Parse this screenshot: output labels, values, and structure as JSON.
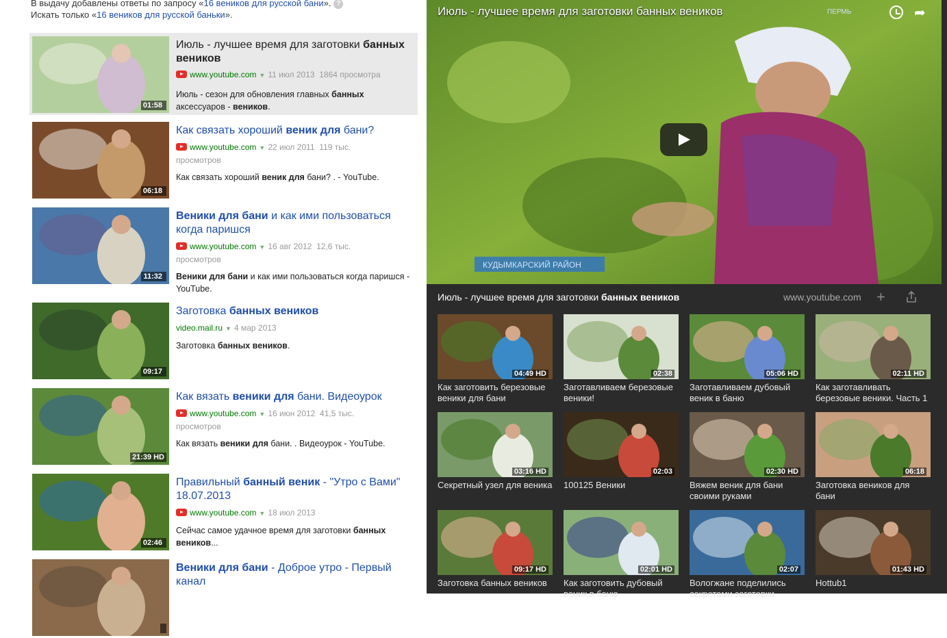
{
  "notice": {
    "line1_prefix": "В выдачу добавлены ответы по запросу «",
    "line1_link": "16 веников для русской бани",
    "line1_suffix": "».",
    "line2_prefix": "Искать только «",
    "line2_link": "16 веников для русской баньки",
    "line2_suffix": "»."
  },
  "results": [
    {
      "title_plain1": "Июль - лучшее время для заготовки ",
      "title_bold1": "банных веников",
      "title_plain2": "",
      "title_bold2": "",
      "title_plain3": "",
      "source": "www.youtube.com",
      "date": "11 июл 2013",
      "views": "1864 просмотра",
      "views2": "",
      "desc_plain1": "Июль - сезон для обновления главных ",
      "desc_bold1": "банных",
      "desc_plain2": " аксессуаров - ",
      "desc_bold2": "веников",
      "desc_plain3": ".",
      "duration": "01:58",
      "hd": ""
    },
    {
      "title_plain1": "Как связать хороший ",
      "title_bold1": "веник для",
      "title_plain2": " бани?",
      "title_bold2": "",
      "title_plain3": "",
      "source": "www.youtube.com",
      "date": "22 июл 2011",
      "views": "119 тыс.",
      "views2": "просмотров",
      "desc_plain1": "Как связать хороший ",
      "desc_bold1": "веник для",
      "desc_plain2": " бани? . - YouTube.",
      "desc_bold2": "",
      "desc_plain3": "",
      "duration": "06:18",
      "hd": ""
    },
    {
      "title_plain1": "",
      "title_bold1": "Веники для бани",
      "title_plain2": " и как ими пользоваться когда паришся",
      "title_bold2": "",
      "title_plain3": "",
      "source": "www.youtube.com",
      "date": "16 авг 2012",
      "views": "12,6 тыс.",
      "views2": "просмотров",
      "desc_plain1": "",
      "desc_bold1": "Веники для бани",
      "desc_plain2": " и как ими пользоваться когда паришся - YouTube.",
      "desc_bold2": "",
      "desc_plain3": "",
      "duration": "11:32",
      "hd": ""
    },
    {
      "title_plain1": "Заготовка ",
      "title_bold1": "банных веников",
      "title_plain2": "",
      "title_bold2": "",
      "title_plain3": "",
      "source": "video.mail.ru",
      "date": "4 мар 2013",
      "views": "",
      "views2": "",
      "desc_plain1": "Заготовка ",
      "desc_bold1": "банных веников",
      "desc_plain2": ".",
      "desc_bold2": "",
      "desc_plain3": "",
      "duration": "09:17",
      "hd": ""
    },
    {
      "title_plain1": "Как вязать ",
      "title_bold1": "веники для",
      "title_plain2": " бани. Видеоурок",
      "title_bold2": "",
      "title_plain3": "",
      "source": "www.youtube.com",
      "date": "16 июн 2012",
      "views": "41,5 тыс.",
      "views2": "просмотров",
      "desc_plain1": "Как вязать ",
      "desc_bold1": "веники для",
      "desc_plain2": " бани. . Видеоурок - YouTube.",
      "desc_bold2": "",
      "desc_plain3": "",
      "duration": "21:39",
      "hd": "HD"
    },
    {
      "title_plain1": "Правильный ",
      "title_bold1": "банный веник",
      "title_plain2": " - \"Утро с Вами\" 18.07.2013",
      "title_bold2": "",
      "title_plain3": "",
      "source": "www.youtube.com",
      "date": "18 июл 2013",
      "views": "",
      "views2": "",
      "desc_plain1": "Сейчас самое удачное время для заготовки ",
      "desc_bold1": "банных веников",
      "desc_plain2": "...",
      "desc_bold2": "",
      "desc_plain3": "",
      "duration": "02:46",
      "hd": ""
    },
    {
      "title_plain1": "",
      "title_bold1": "Веники для бани",
      "title_plain2": " - Доброе утро - Первый канал",
      "title_bold2": "",
      "title_plain3": "",
      "source": "",
      "date": "",
      "views": "",
      "views2": "",
      "desc_plain1": "",
      "desc_bold1": "",
      "desc_plain2": "",
      "desc_bold2": "",
      "desc_plain3": "",
      "duration": "",
      "hd": ""
    }
  ],
  "player": {
    "title": "Июль - лучшее время для заготовки банных веников",
    "caption_plain": "Июль - лучшее время для заготовки ",
    "caption_bold": "банных веников",
    "host": "www.youtube.com",
    "overlay_text": "КУДЫМКАРСКИЙ РАЙОН",
    "corner_text": "ПЕРМЬ"
  },
  "related": [
    {
      "title": "Как заготовить березовые веники для бани",
      "duration": "04:49",
      "hd": "HD"
    },
    {
      "title": "Заготавливаем березовые веники!",
      "duration": "02:38",
      "hd": ""
    },
    {
      "title": "Заготавливаем дубовый веник в баню",
      "duration": "05:06",
      "hd": "HD"
    },
    {
      "title": "Как заготавливать березовые веники. Часть 1",
      "duration": "02:11",
      "hd": "HD"
    },
    {
      "title": "Секретный узел для веника",
      "duration": "03:16",
      "hd": "HD"
    },
    {
      "title": "100125 Веники",
      "duration": "02:03",
      "hd": ""
    },
    {
      "title": "Вяжем веник для бани своими руками",
      "duration": "02:30",
      "hd": "HD"
    },
    {
      "title": "Заготовка веников для бани",
      "duration": "06:18",
      "hd": ""
    },
    {
      "title": "Заготовка банных веников",
      "duration": "09:17",
      "hd": "HD"
    },
    {
      "title": "Как заготовить дубовый веник в баню",
      "duration": "02:01",
      "hd": "HD"
    },
    {
      "title": "Вологжане поделились секретами заготовки",
      "duration": "02:07",
      "hd": ""
    },
    {
      "title": "Hottub1",
      "duration": "01:43",
      "hd": "HD"
    }
  ],
  "colors": {
    "link": "#1f4ea8",
    "source_green": "#007700",
    "panel_bg": "#2b2b2b",
    "youtube_red": "#e52d27"
  }
}
